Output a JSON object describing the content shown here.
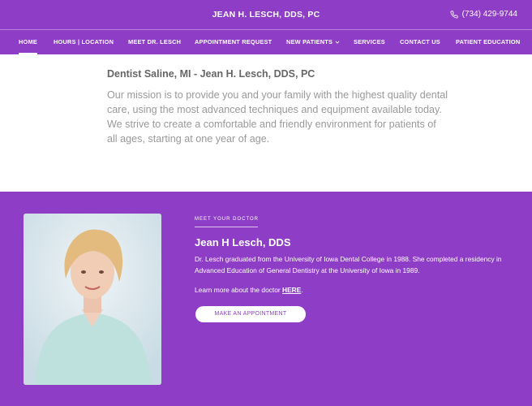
{
  "header": {
    "brand": "JEAN H. LESCH, DDS, PC",
    "phone": "(734) 429-9744"
  },
  "nav": {
    "items": [
      {
        "label": "HOME",
        "active": true
      },
      {
        "label": "HOURS | LOCATION"
      },
      {
        "label": "MEET DR. LESCH"
      },
      {
        "label": "APPOINTMENT REQUEST"
      },
      {
        "label": "NEW PATIENTS",
        "dropdown": true
      },
      {
        "label": "SERVICES"
      },
      {
        "label": "CONTACT US"
      },
      {
        "label": "PATIENT EDUCATION"
      }
    ]
  },
  "intro": {
    "heading": "Dentist Saline, MI - Jean H. Lesch, DDS, PC",
    "body": "Our mission is to provide you and your family with the highest quality dental care, using the most advanced techniques and equipment available today.  We strive to create a comfortable and friendly environment for patients of all ages, starting at one year of age."
  },
  "bio": {
    "eyebrow": "MEET YOUR DOCTOR",
    "name": "Jean H Lesch, DDS",
    "text": "Dr. Lesch graduated from the University of Iowa Dental College in 1988.  She completed a residency in Advanced Education of General Dentistry at the University of Iowa in 1989.",
    "more_prefix": "Learn more about the doctor ",
    "more_link": "HERE",
    "more_suffix": ".",
    "button": "MAKE AN APPOINTMENT"
  },
  "colors": {
    "brand_purple": "#8d3dc6",
    "white": "#ffffff"
  }
}
